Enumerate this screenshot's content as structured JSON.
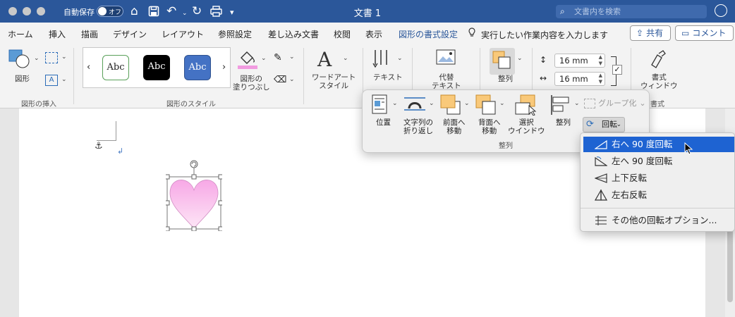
{
  "app": {
    "autosave_label": "自動保存",
    "autosave_toggle": "オフ",
    "document_title": "文書 1",
    "search_placeholder": "文書内を検索"
  },
  "tabs": [
    {
      "label": "ホーム"
    },
    {
      "label": "挿入"
    },
    {
      "label": "描画"
    },
    {
      "label": "デザイン"
    },
    {
      "label": "レイアウト"
    },
    {
      "label": "参照設定"
    },
    {
      "label": "差し込み文書"
    },
    {
      "label": "校閲"
    },
    {
      "label": "表示"
    },
    {
      "label": "図形の書式設定",
      "active": true
    }
  ],
  "tell_me": "実行したい作業内容を入力します",
  "share_label": "共有",
  "comment_label": "コメント",
  "ribbon": {
    "shapes_label": "図形",
    "insert_shapes_group": "図形の挿入",
    "style_sample": "Abc",
    "shape_styles_group": "図形のスタイル",
    "fill_label": "図形の\n塗りつぶし",
    "wordart_label": "ワードアート\nスタイル",
    "text_label": "テキスト",
    "alt_text_label": "代替\nテキスト",
    "arrange_label": "整列",
    "height_value": "16 mm",
    "width_value": "16 mm",
    "format_pane_label": "書式\nウィンドウ",
    "format_group_partial": "書式"
  },
  "arrange_popover": {
    "position": "位置",
    "wrap_text": "文字列の\n折り返し",
    "bring_forward": "前面へ\n移動",
    "send_backward": "背面へ\n移動",
    "selection_pane": "選択\nウインドウ",
    "align": "整列",
    "group": "グループ化",
    "rotate": "回転",
    "group_label": "整列"
  },
  "rotate_menu": {
    "items": [
      {
        "label": "右へ 90 度回転",
        "highlighted": true
      },
      {
        "label": "左へ 90 度回転"
      },
      {
        "label": "上下反転"
      },
      {
        "label": "左右反転"
      }
    ],
    "more_options": "その他の回転オプション..."
  },
  "colors": {
    "title_bar": "#2b579a",
    "accent": "#2b579a",
    "menu_highlight": "#1e63d2",
    "heart_fill": "#f7a8e6"
  }
}
